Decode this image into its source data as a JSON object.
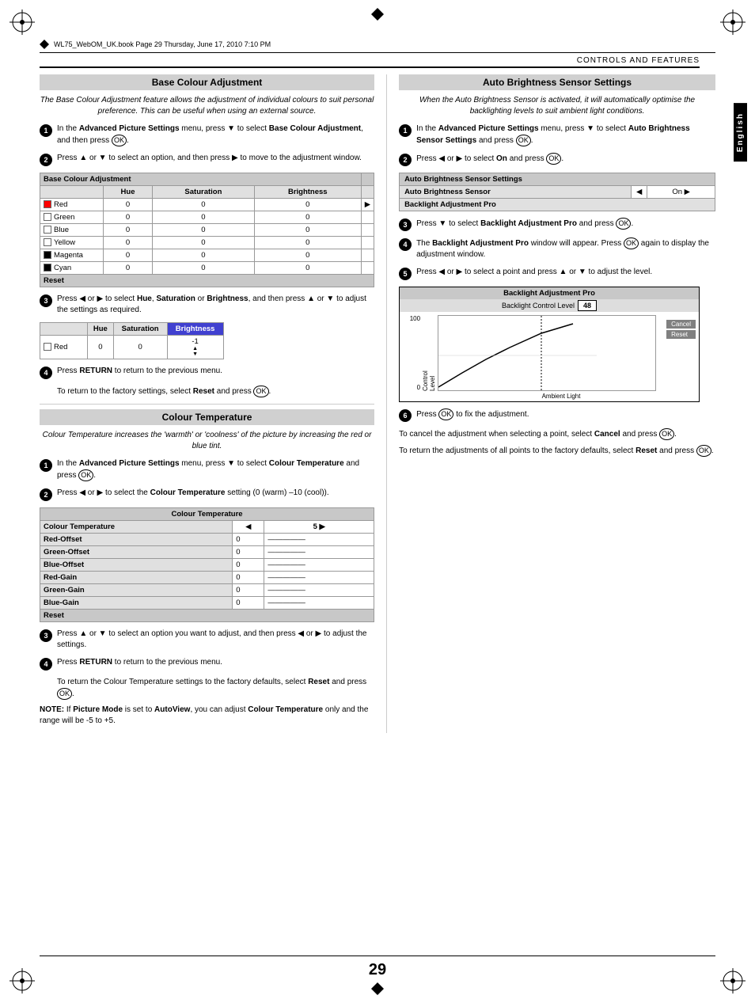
{
  "page": {
    "number": "29",
    "filename": "WL75_WebOM_UK.book  Page 29  Thursday, June 17, 2010  7:10 PM",
    "top_right_label": "CONTROLS AND FEATURES",
    "right_tab_label": "English"
  },
  "left_col": {
    "base_colour_adjustment": {
      "title": "Base Colour Adjustment",
      "desc": "The Base Colour Adjustment feature allows the adjustment of individual colours to suit personal preference. This can be useful when using an external source.",
      "steps": [
        {
          "num": "1",
          "text": "In the Advanced Picture Settings menu, press ▼ to select Base Colour Adjustment, and then press ."
        },
        {
          "num": "2",
          "text": "Press ▲ or ▼ to select an option, and then press ▶ to move to the adjustment window."
        },
        {
          "num": "3",
          "text": "Press ◀ or ▶ to select Hue, Saturation or Brightness, and then press ▲ or ▼ to adjust the settings as required."
        },
        {
          "num": "4",
          "text": "Press RETURN to return to the previous menu."
        }
      ],
      "step4_note": "To return to the factory settings, select Reset and press .",
      "table1": {
        "header": "Base Colour Adjustment",
        "cols": [
          "Hue",
          "Saturation",
          "Brightness"
        ],
        "rows": [
          {
            "label": "Red",
            "swatch": "red",
            "values": [
              "0",
              "0",
              "0"
            ]
          },
          {
            "label": "Green",
            "swatch": "green",
            "values": [
              "0",
              "0",
              "0"
            ]
          },
          {
            "label": "Blue",
            "swatch": "blue",
            "values": [
              "0",
              "0",
              "0"
            ]
          },
          {
            "label": "Yellow",
            "swatch": "yellow",
            "values": [
              "0",
              "0",
              "0"
            ]
          },
          {
            "label": "Magenta",
            "swatch": "magenta",
            "values": [
              "0",
              "0",
              "0"
            ]
          },
          {
            "label": "Cyan",
            "swatch": "cyan",
            "values": [
              "0",
              "0",
              "0"
            ]
          }
        ],
        "reset_label": "Reset"
      },
      "table2": {
        "cols": [
          "Hue",
          "Saturation",
          "Brightness"
        ],
        "rows": [
          {
            "label": "Red",
            "swatch": "red",
            "values": [
              "0",
              "0",
              "-1"
            ]
          }
        ]
      }
    },
    "colour_temperature": {
      "title": "Colour Temperature",
      "desc": "Colour Temperature increases the 'warmth' or 'coolness' of the picture by increasing the red or blue tint.",
      "steps": [
        {
          "num": "1",
          "text": "In the Advanced Picture Settings menu, press ▼ to select Colour Temperature and press ."
        },
        {
          "num": "2",
          "text": "Press ◀ or ▶ to select the Colour Temperature setting (0 (warm) –10 (cool))."
        },
        {
          "num": "3",
          "text": "Press ▲ or ▼ to select an option you want to adjust, and then press ◀ or ▶ to adjust the settings."
        },
        {
          "num": "4",
          "text": "Press RETURN to return to the previous menu."
        }
      ],
      "step4_note1": "To return the Colour Temperature settings to the factory defaults, select Reset and press .",
      "note_text": "NOTE: If Picture Mode is set to AutoView, you can adjust Colour Temperature only and the range will be -5 to +5.",
      "ct_table": {
        "header": "Colour Temperature",
        "col_label": "Colour Temperature",
        "col_value": "5",
        "rows": [
          {
            "label": "Red-Offset",
            "value": "0"
          },
          {
            "label": "Green-Offset",
            "value": "0"
          },
          {
            "label": "Blue-Offset",
            "value": "0"
          },
          {
            "label": "Red-Gain",
            "value": "0"
          },
          {
            "label": "Green-Gain",
            "value": "0"
          },
          {
            "label": "Blue-Gain",
            "value": "0"
          }
        ],
        "reset_label": "Reset"
      }
    }
  },
  "right_col": {
    "auto_brightness": {
      "title": "Auto Brightness Sensor Settings",
      "desc": "When the Auto Brightness Sensor is activated, it will automatically optimise the backlighting levels to suit ambient light conditions.",
      "steps": [
        {
          "num": "1",
          "text": "In the Advanced Picture Settings menu, press ▼ to select Auto Brightness Sensor Settings and press ."
        },
        {
          "num": "2",
          "text": "Press ◀ or ▶ to select On and press ."
        },
        {
          "num": "3",
          "text": "Press ▼ to select Backlight Adjustment Pro and press ."
        },
        {
          "num": "4",
          "text": "The Backlight Adjustment Pro window will appear. Press  again to display the adjustment window."
        },
        {
          "num": "5",
          "text": "Press ◀ or ▶ to select a point and press ▲ or ▼ to adjust the level."
        },
        {
          "num": "6",
          "text": "Press  to fix the adjustment."
        }
      ],
      "step6_note1": "To cancel the adjustment when selecting a point, select Cancel and press .",
      "step6_note2": "To return the adjustments of all points to the factory defaults, select Reset and press .",
      "abs_table": {
        "header": "Auto Brightness Sensor Settings",
        "rows": [
          {
            "label": "Auto Brightness Sensor",
            "value": "On"
          },
          {
            "label": "Backlight Adjustment Pro",
            "value": ""
          }
        ]
      },
      "chart": {
        "title": "Backlight Adjustment Pro",
        "subtitle": "Backlight Control Level",
        "value": "48",
        "y_max": "100",
        "y_min": "0",
        "y_axis_label": "Control Level",
        "x_axis_label": "Ambient Light",
        "cancel_label": "Cancel",
        "reset_label": "Reset"
      }
    }
  }
}
